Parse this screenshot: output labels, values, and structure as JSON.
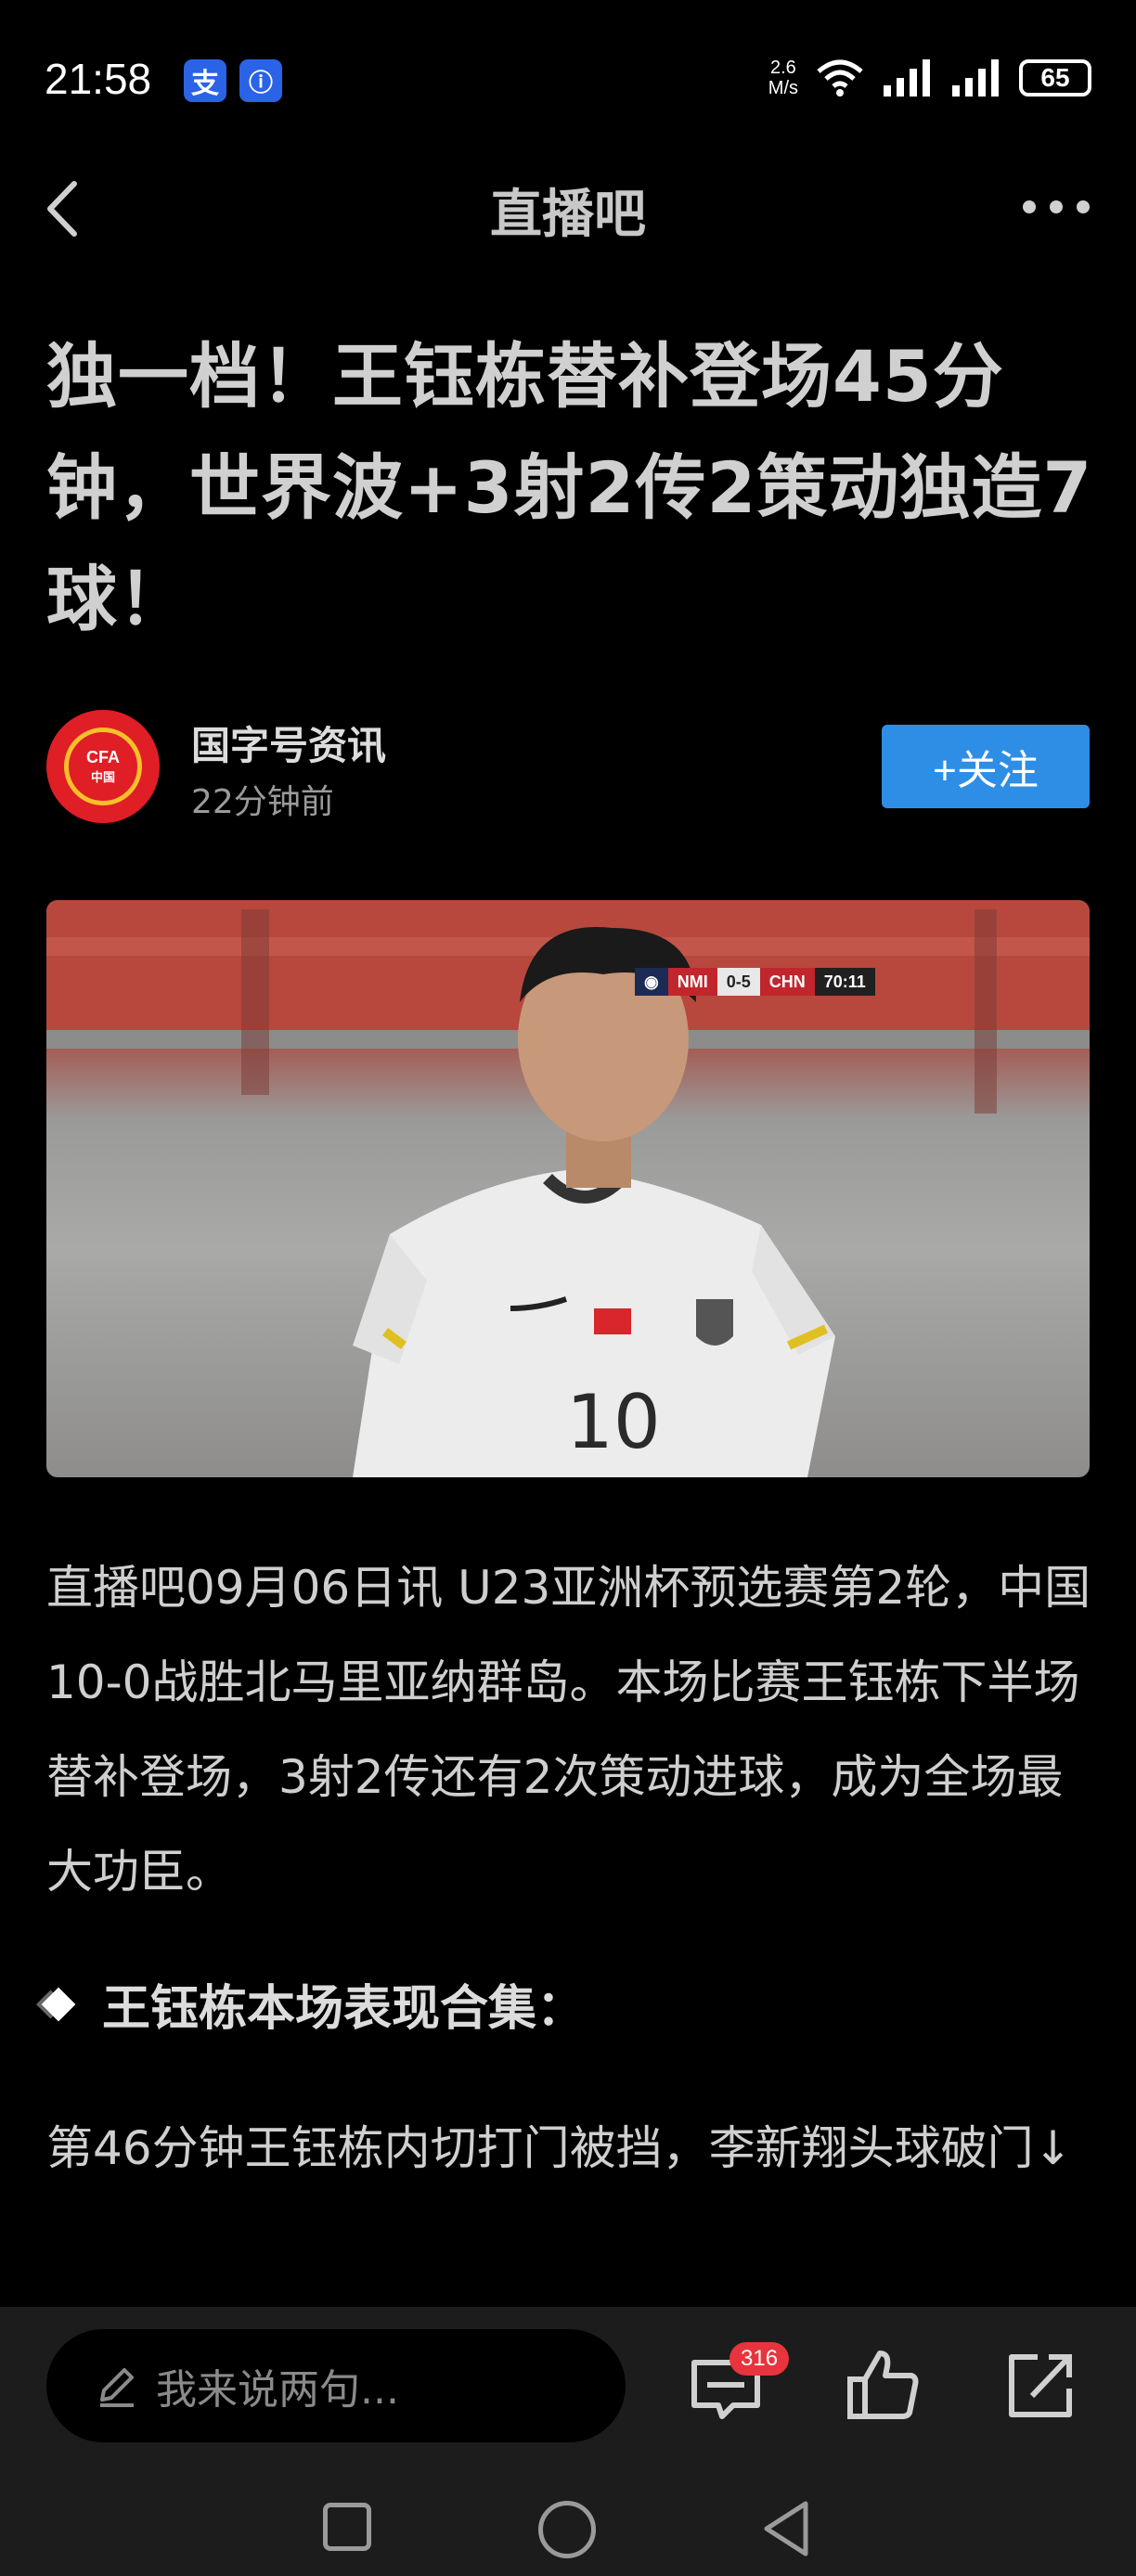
{
  "status_bar": {
    "time": "21:58",
    "app_icons": [
      "支",
      "ⓘ"
    ],
    "net_speed_value": "2.6",
    "net_speed_unit": "M/s",
    "battery": "65"
  },
  "header": {
    "title": "直播吧"
  },
  "article": {
    "title": "独一档！王钰栋替补登场45分钟，世界波+3射2传2策动独造7球！",
    "author": {
      "name": "国字号资讯",
      "time": "22分钟前",
      "avatar_text_top": "CFA",
      "avatar_text_bottom": "中国"
    },
    "follow_label": "+关注",
    "image": {
      "scoreboard": {
        "team1": "NMI",
        "score": "0-5",
        "team2": "CHN",
        "clock": "70:11"
      },
      "jersey_number": "10"
    },
    "paragraph1": "直播吧09月06日讯 U23亚洲杯预选赛第2轮，中国10-0战胜北马里亚纳群岛。本场比赛王钰栋下半场替补登场，3射2传还有2次策动进球，成为全场最大功臣。",
    "section_heading": "王钰栋本场表现合集：",
    "paragraph2": "第46分钟王钰栋内切打门被挡，李新翔头球破门↓"
  },
  "bottom_bar": {
    "comment_placeholder": "我来说两句...",
    "comment_count": "316"
  },
  "colors": {
    "background": "#000000",
    "accent": "#2e8ee6",
    "badge": "#e8343c"
  },
  "icons": [
    "back-icon",
    "more-icon",
    "pen-icon",
    "comment-icon",
    "like-icon",
    "share-icon",
    "diamond-icon"
  ]
}
